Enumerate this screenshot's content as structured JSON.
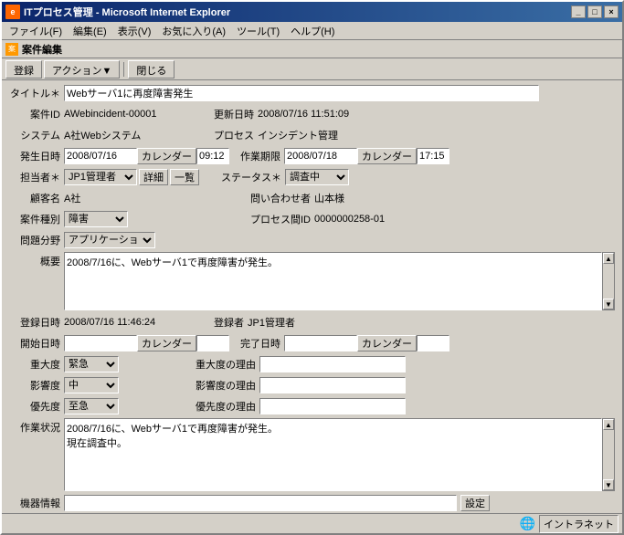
{
  "window": {
    "title": "ITプロセス管理 - Microsoft Internet Explorer",
    "close_btn": "×",
    "min_btn": "_",
    "max_btn": "□"
  },
  "menu": {
    "items": [
      "ファイル(F)",
      "編集(E)",
      "表示(V)",
      "お気に入り(A)",
      "ツール(T)",
      "ヘルプ(H)"
    ]
  },
  "toolbar": {
    "register_label": "登録",
    "action_label": "アクション▼",
    "close_label": "閉じる"
  },
  "section": {
    "title": "案件編集"
  },
  "form": {
    "title_label": "タイトル＊",
    "title_value": "Webサーバ1に再度障害発生",
    "case_id_label": "案件ID",
    "case_id_value": "AWebincident-00001",
    "updated_label": "更新日時",
    "updated_value": "2008/07/16 11:51:09",
    "system_label": "システム",
    "system_value": "A社Webシステム",
    "process_label": "プロセス",
    "process_value": "インシデント管理",
    "occur_date_label": "発生日時",
    "occur_date_value": "2008/07/16",
    "occur_time_value": "09:12",
    "work_limit_label": "作業期限",
    "work_limit_date": "2008/07/18",
    "work_limit_time": "17:15",
    "calendar_label": "カレンダー",
    "assignee_label": "担当者＊",
    "assignee_value": "JP1管理者▼",
    "detail_btn": "詳細",
    "list_btn": "一覧",
    "status_label": "ステータス＊",
    "status_value": "調査中",
    "customer_label": "顧客名",
    "customer_value": "A社",
    "inquiry_label": "問い合わせ者",
    "inquiry_value": "山本様",
    "case_type_label": "案件種別",
    "case_type_value": "障害",
    "process_id_label": "プロセス間ID",
    "process_id_value": "0000000258-01",
    "problem_label": "問題分野",
    "problem_value": "アプリケーション",
    "summary_label": "概要",
    "summary_value": "2008/7/16に、Webサーバ1で再度障害が発生。",
    "reg_date_label": "登録日時",
    "reg_date_value": "2008/07/16 11:46:24",
    "registrant_label": "登録者",
    "registrant_value": "JP1管理者",
    "start_date_label": "開始日時",
    "start_date_value": "",
    "start_time_value": "",
    "complete_date_label": "完了日時",
    "complete_date_value": "",
    "complete_time_value": "",
    "severity_label": "重大度",
    "severity_value": "緊急",
    "severity_reason_label": "重大度の理由",
    "severity_reason_value": "",
    "impact_label": "影響度",
    "impact_value": "中",
    "impact_reason_label": "影響度の理由",
    "impact_reason_value": "",
    "priority_label": "優先度",
    "priority_value": "至急",
    "priority_reason_label": "優先度の理由",
    "priority_reason_value": "",
    "work_status_label": "作業状況",
    "work_status_value": "2008/7/16に、Webサーバ1で再度障害が発生。\n現在調査中。",
    "equipment_label": "機器情報",
    "equipment_value": "",
    "setting_btn": "設定"
  },
  "statusbar": {
    "internet_label": "イントラネット"
  }
}
